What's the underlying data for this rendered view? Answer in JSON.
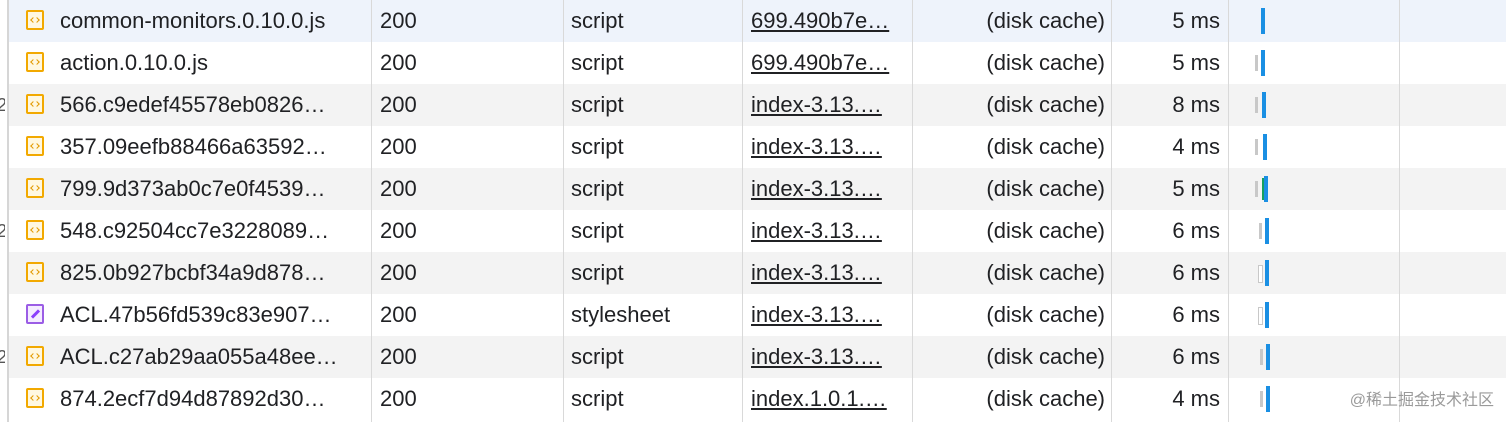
{
  "rows": [
    {
      "name": "common-monitors.0.10.0.js",
      "status": "200",
      "type": "script",
      "initiator": "699.490b7e…",
      "size": "(disk cache)",
      "time": "5 ms",
      "icon": "script-file-icon",
      "waterfall": {
        "wait_fraction": 0.0,
        "bar_offset_px_hint": "none"
      }
    },
    {
      "name": "action.0.10.0.js",
      "status": "200",
      "type": "script",
      "initiator": "699.490b7e…",
      "size": "(disk cache)",
      "time": "5 ms",
      "icon": "script-file-icon"
    },
    {
      "name": "566.c9edef45578eb0826…",
      "status": "200",
      "type": "script",
      "initiator": "index-3.13.…",
      "size": "(disk cache)",
      "time": "8 ms",
      "icon": "script-file-icon"
    },
    {
      "name": "357.09eefb88466a63592…",
      "status": "200",
      "type": "script",
      "initiator": "index-3.13.…",
      "size": "(disk cache)",
      "time": "4 ms",
      "icon": "script-file-icon"
    },
    {
      "name": "799.9d373ab0c7e0f4539…",
      "status": "200",
      "type": "script",
      "initiator": "index-3.13.…",
      "size": "(disk cache)",
      "time": "5 ms",
      "icon": "script-file-icon"
    },
    {
      "name": "548.c92504cc7e3228089…",
      "status": "200",
      "type": "script",
      "initiator": "index-3.13.…",
      "size": "(disk cache)",
      "time": "6 ms",
      "icon": "script-file-icon"
    },
    {
      "name": "825.0b927bcbf34a9d878…",
      "status": "200",
      "type": "script",
      "initiator": "index-3.13.…",
      "size": "(disk cache)",
      "time": "6 ms",
      "icon": "script-file-icon"
    },
    {
      "name": "ACL.47b56fd539c83e907…",
      "status": "200",
      "type": "stylesheet",
      "initiator": "index-3.13.…",
      "size": "(disk cache)",
      "time": "6 ms",
      "icon": "stylesheet-file-icon"
    },
    {
      "name": "ACL.c27ab29aa055a48ee…",
      "status": "200",
      "type": "script",
      "initiator": "index-3.13.…",
      "size": "(disk cache)",
      "time": "6 ms",
      "icon": "script-file-icon"
    },
    {
      "name": "874.2ecf7d94d87892d30…",
      "status": "200",
      "type": "script",
      "initiator": "index.1.0.1.…",
      "size": "(disk cache)",
      "time": "4 ms",
      "icon": "script-file-icon"
    }
  ],
  "colors": {
    "waterfall_bar": "#1a8fe3",
    "waterfall_wait": "#c8c8c8",
    "waterfall_green": "#18a05e",
    "script_icon": "#f2a900",
    "stylesheet_icon": "#9b5de5"
  },
  "watermark": "@稀土掘金技术社区"
}
